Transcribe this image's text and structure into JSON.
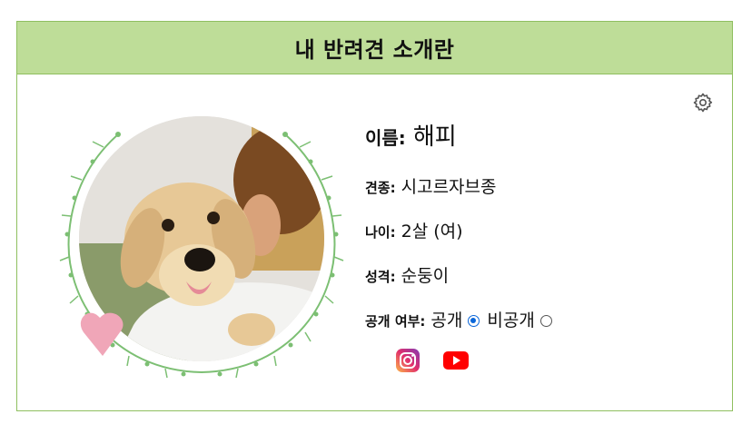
{
  "header": {
    "title": "내 반려견 소개란"
  },
  "profile": {
    "name_label": "이름:",
    "name_value": "해피",
    "breed_label": "견종:",
    "breed_value": "시고르자브종",
    "age_label": "나이:",
    "age_value": "2살 (여)",
    "personality_label": "성격:",
    "personality_value": "순둥이",
    "visibility_label": "공개 여부:",
    "visibility_options": [
      "공개",
      "비공개"
    ],
    "visibility_selected": "공개"
  },
  "social": {
    "icons": [
      "instagram-icon",
      "youtube-icon"
    ]
  },
  "colors": {
    "header_bg": "#bedd98",
    "border": "#8fbf5f",
    "wreath": "#7cbf73",
    "heart": "#f0a6b8",
    "radio_accent": "#0a66d9",
    "youtube": "#ff0000"
  }
}
